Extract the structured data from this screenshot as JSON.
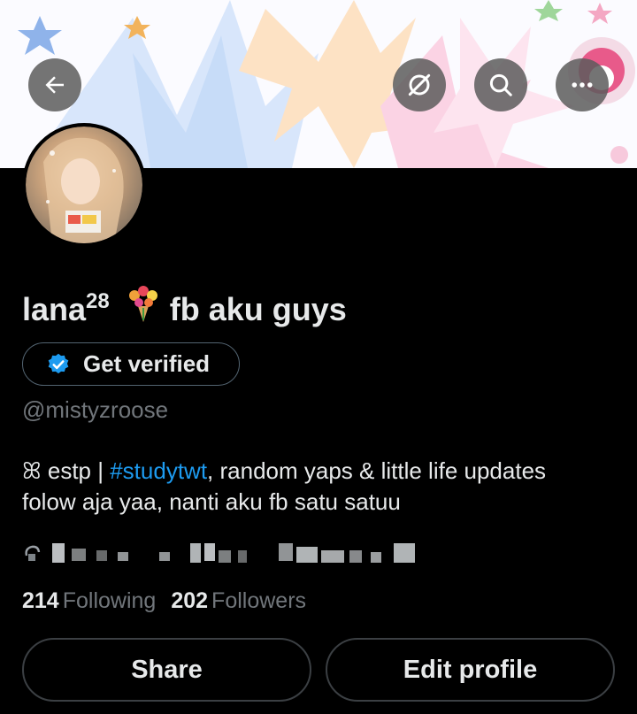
{
  "header": {
    "back_icon": "arrow-left-icon",
    "grok_icon": "grok-slash-circle-icon",
    "search_icon": "search-icon",
    "more_icon": "more-dots-icon"
  },
  "profile": {
    "display_name": "lana",
    "display_name_superscript": "28",
    "name_emoji": "💐",
    "name_suffix": "fb aku guys",
    "handle": "@mistyzroose"
  },
  "verify": {
    "label": "Get verified",
    "badge_color": "#1d9bf0"
  },
  "bio": {
    "prefix_symbol": "ꕤ",
    "text_before_tag": " estp | ",
    "hashtag": "#studytwt",
    "text_after_tag": ", random yaps & little life updates",
    "line2": "folow aja yaa, nanti aku fb satu satuu"
  },
  "stats": {
    "following_count": "214",
    "following_label": "Following",
    "followers_count": "202",
    "followers_label": "Followers"
  },
  "actions": {
    "share_label": "Share",
    "edit_label": "Edit profile"
  },
  "colors": {
    "background": "#000000",
    "text": "#e7e9ea",
    "muted": "#71767b",
    "accent": "#1d9bf0",
    "border": "#536471"
  }
}
